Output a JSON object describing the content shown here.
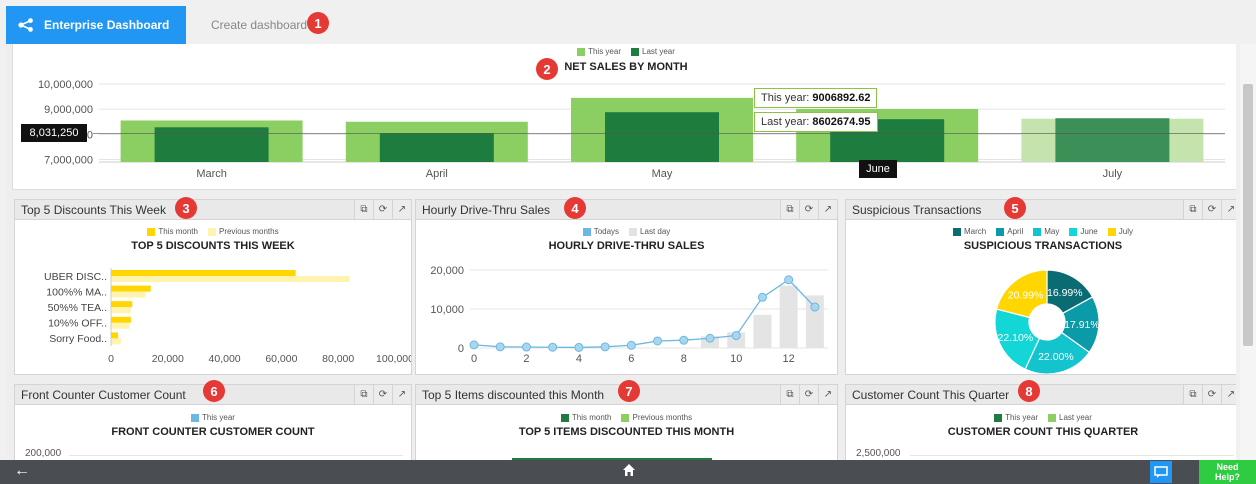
{
  "header": {
    "brand_label": "Enterprise Dashboard",
    "create_tab": "Create dashboard"
  },
  "callouts": [
    "1",
    "2",
    "3",
    "4",
    "5",
    "6",
    "7",
    "8"
  ],
  "sales": {
    "legend": [
      "This year",
      "Last year"
    ],
    "title": "NET SALES BY MONTH",
    "crosshair_value": "8,031,250",
    "highlighted_month": "June",
    "tooltip_this_label": "This year:",
    "tooltip_this_value": "9006892.62",
    "tooltip_last_label": "Last year:",
    "tooltip_last_value": "8602674.95"
  },
  "widgets": {
    "discounts": {
      "header": "Top 5 Discounts This Week",
      "legend": [
        "This month",
        "Previous months"
      ],
      "title": "TOP 5 DISCOUNTS THIS WEEK"
    },
    "drive": {
      "header": "Hourly Drive-Thru Sales",
      "legend": [
        "Todays",
        "Last day"
      ],
      "title": "HOURLY DRIVE-THRU SALES"
    },
    "suspicious": {
      "header": "Suspicious Transactions",
      "legend": [
        "March",
        "April",
        "May",
        "June",
        "July"
      ],
      "title": "SUSPICIOUS TRANSACTIONS"
    },
    "front": {
      "header": "Front Counter Customer Count",
      "legend": [
        "This year"
      ],
      "title": "FRONT COUNTER CUSTOMER COUNT",
      "first_tick": "200,000"
    },
    "items": {
      "header": "Top 5 Items discounted this Month",
      "legend": [
        "This month",
        "Previous months"
      ],
      "title": "TOP 5 ITEMS DISCOUNTED THIS MONTH"
    },
    "quarter": {
      "header": "Customer Count This Quarter",
      "legend": [
        "This year",
        "Last year"
      ],
      "title": "CUSTOMER COUNT THIS QUARTER",
      "first_tick": "2,500,000"
    }
  },
  "bottombar": {
    "help_line1": "Need",
    "help_line2": "Help?"
  },
  "colors": {
    "accent": "#2196f3",
    "light_green": "#8bcf63",
    "dark_green": "#1e7d3e",
    "yellow": "#ffd600",
    "pale_yellow": "#fff3b0",
    "teal_dark": "#0a7680",
    "teal": "#0a9aa8",
    "cyan": "#13d6d6",
    "callout": "#e53935"
  },
  "chart_data": [
    {
      "type": "bar",
      "title": "NET SALES BY MONTH",
      "categories": [
        "March",
        "April",
        "May",
        "June",
        "July"
      ],
      "series": [
        {
          "name": "This year",
          "values": [
            8550000,
            8500000,
            9450000,
            9006892.62,
            8620000
          ]
        },
        {
          "name": "Last year",
          "values": [
            8280000,
            8050000,
            8880000,
            8602674.95,
            8640000
          ]
        }
      ],
      "y_ticks": [
        "7,000,000",
        "8,000,000",
        "9,000,000",
        "10,000,000"
      ],
      "ylim": [
        6900000,
        10000000
      ],
      "legend": "top"
    },
    {
      "type": "bar",
      "orientation": "horizontal",
      "title": "TOP 5 DISCOUNTS THIS WEEK",
      "categories": [
        "UBER DISC..",
        "100%% MA..",
        "50%% TEA..",
        "10%% OFF..",
        "Sorry Food.."
      ],
      "series": [
        {
          "name": "This month",
          "values": [
            65000,
            14000,
            7500,
            7000,
            2500
          ]
        },
        {
          "name": "Previous months",
          "values": [
            84000,
            12000,
            7000,
            6500,
            3500
          ]
        }
      ],
      "x_ticks": [
        "0",
        "20,000",
        "40,000",
        "60,000",
        "80,000",
        "100,000"
      ],
      "xlim": [
        0,
        100000
      ]
    },
    {
      "type": "line",
      "title": "HOURLY DRIVE-THRU SALES",
      "x": [
        0,
        1,
        2,
        3,
        4,
        5,
        6,
        7,
        8,
        9,
        10,
        11,
        12,
        13
      ],
      "series": [
        {
          "name": "Todays",
          "values": [
            800,
            300,
            250,
            200,
            150,
            300,
            700,
            1800,
            2000,
            2500,
            3200,
            13000,
            17500,
            10500
          ]
        },
        {
          "name": "Last day",
          "values": [
            0,
            0,
            0,
            0,
            0,
            0,
            0,
            0,
            0,
            3000,
            4000,
            8500,
            16000,
            13500
          ]
        }
      ],
      "x_ticks": [
        "0",
        "2",
        "4",
        "6",
        "8",
        "10",
        "12"
      ],
      "y_ticks": [
        "0",
        "10,000",
        "20,000"
      ],
      "ylim": [
        0,
        20000
      ]
    },
    {
      "type": "pie",
      "title": "SUSPICIOUS TRANSACTIONS",
      "labels": [
        "March",
        "April",
        "May",
        "June",
        "July"
      ],
      "values": [
        16.99,
        17.91,
        22.0,
        22.1,
        20.99
      ],
      "value_labels": [
        "16.99%",
        "17.91%",
        "22.00%",
        "22.10%",
        "20.99%"
      ]
    }
  ]
}
